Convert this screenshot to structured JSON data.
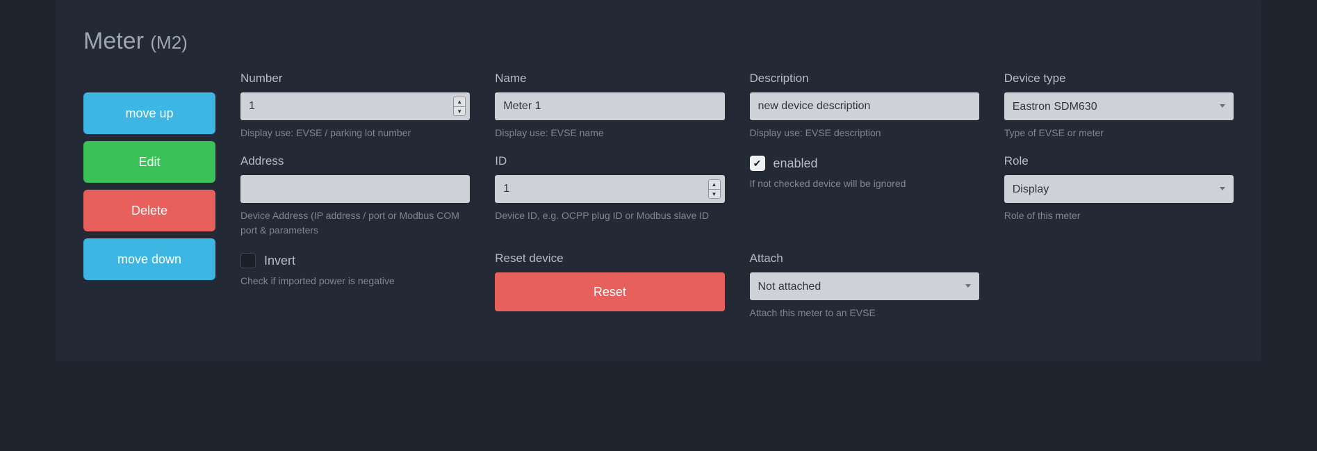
{
  "title": {
    "main": "Meter",
    "sub": "(M2)"
  },
  "actions": {
    "move_up": "move up",
    "edit": "Edit",
    "delete": "Delete",
    "move_down": "move down"
  },
  "fields": {
    "number": {
      "label": "Number",
      "value": "1",
      "help": "Display use: EVSE / parking lot number"
    },
    "name": {
      "label": "Name",
      "value": "Meter 1",
      "help": "Display use: EVSE name"
    },
    "description": {
      "label": "Description",
      "value": "new device description",
      "help": "Display use: EVSE description"
    },
    "device_type": {
      "label": "Device type",
      "value": "Eastron SDM630",
      "help": "Type of EVSE or meter"
    },
    "address": {
      "label": "Address",
      "value": "",
      "help": "Device Address (IP address / port or Modbus COM port & parameters"
    },
    "id": {
      "label": "ID",
      "value": "1",
      "help": "Device ID, e.g. OCPP plug ID or Modbus slave ID"
    },
    "enabled": {
      "label": "enabled",
      "checked": true,
      "help": "If not checked device will be ignored"
    },
    "role": {
      "label": "Role",
      "value": "Display",
      "help": "Role of this meter"
    },
    "invert": {
      "label": "Invert",
      "checked": false,
      "help": "Check if imported power is negative"
    },
    "reset": {
      "label": "Reset device",
      "button": "Reset"
    },
    "attach": {
      "label": "Attach",
      "value": "Not attached",
      "help": "Attach this meter to an EVSE"
    }
  }
}
